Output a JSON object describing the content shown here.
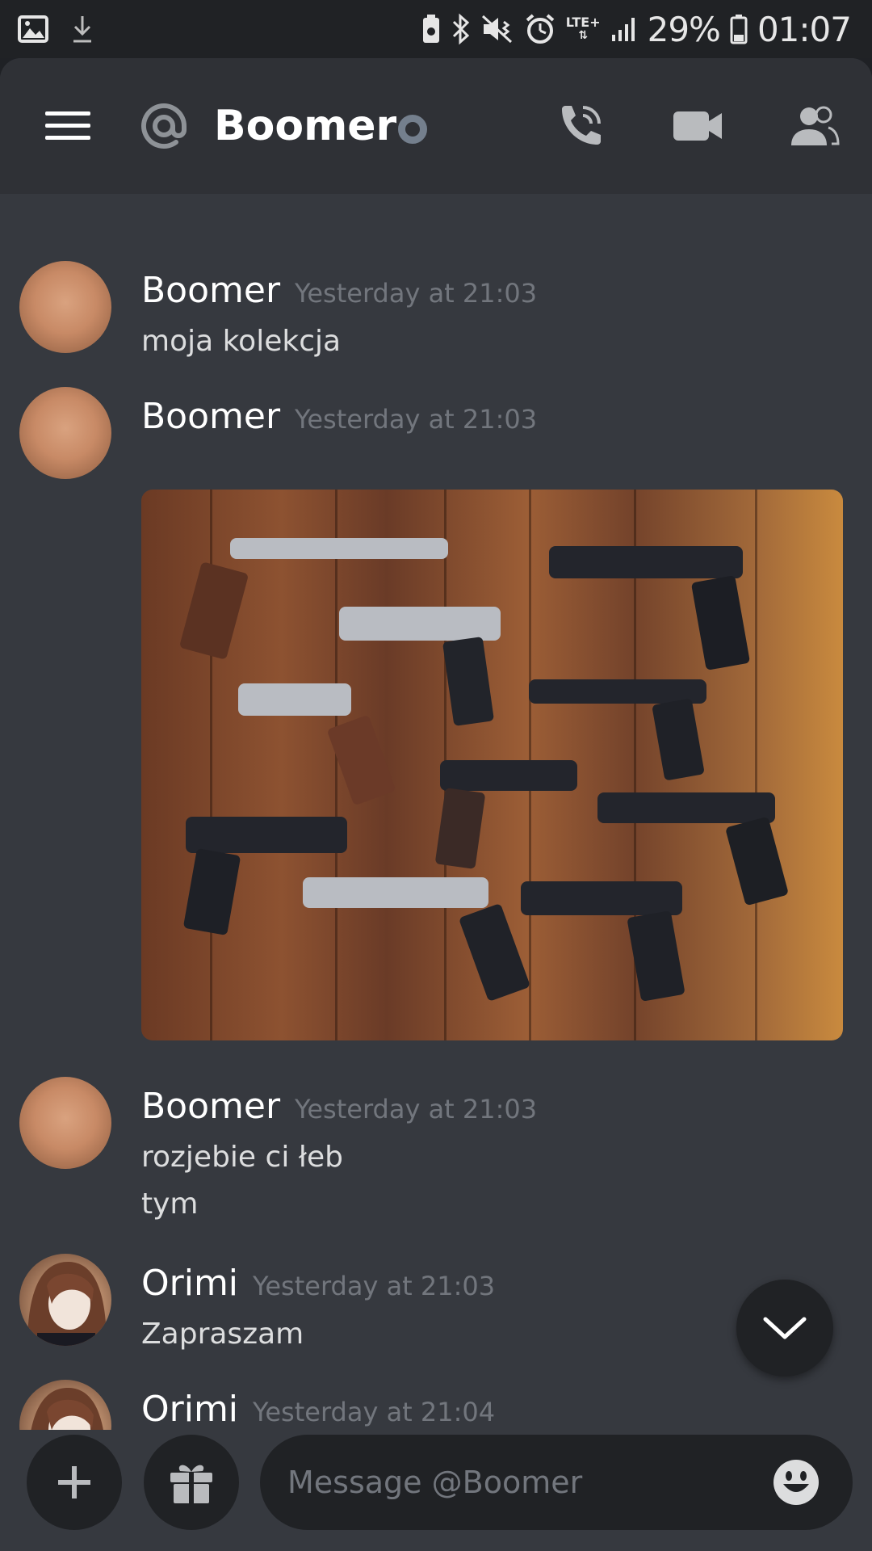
{
  "status_bar": {
    "battery": "29%",
    "time": "01:07",
    "network": "LTE+"
  },
  "header": {
    "channel_name": "Boomer"
  },
  "messages": [
    {
      "author": "Boomer",
      "time": "Yesterday at 21:03",
      "lines": [
        "moja kolekcja"
      ],
      "avatar": "boomer"
    },
    {
      "author": "Boomer",
      "time": "Yesterday at 21:03",
      "lines": [],
      "attachment": "image",
      "avatar": "boomer"
    },
    {
      "author": "Boomer",
      "time": "Yesterday at 21:03",
      "lines": [
        "rozjebie ci łeb",
        "tym"
      ],
      "avatar": "boomer"
    },
    {
      "author": "Orimi",
      "time": "Yesterday at 21:03",
      "lines": [
        "Zapraszam"
      ],
      "avatar": "orimi"
    },
    {
      "author": "Orimi",
      "time": "Yesterday at 21:04",
      "lines": [],
      "avatar": "orimi"
    }
  ],
  "composer": {
    "placeholder": "Message @Boomer"
  },
  "icons": {
    "menu": "hamburger-icon",
    "mention": "at-icon",
    "call": "phone-call-icon",
    "video": "video-camera-icon",
    "members": "members-icon",
    "add": "plus-icon",
    "gift": "gift-icon",
    "emoji": "emoji-icon",
    "jump": "chevron-down-icon"
  },
  "colors": {
    "background": "#36393f",
    "header": "#2f3136",
    "dark": "#202225",
    "muted": "#72767d",
    "status_idle": "#747f8d"
  }
}
